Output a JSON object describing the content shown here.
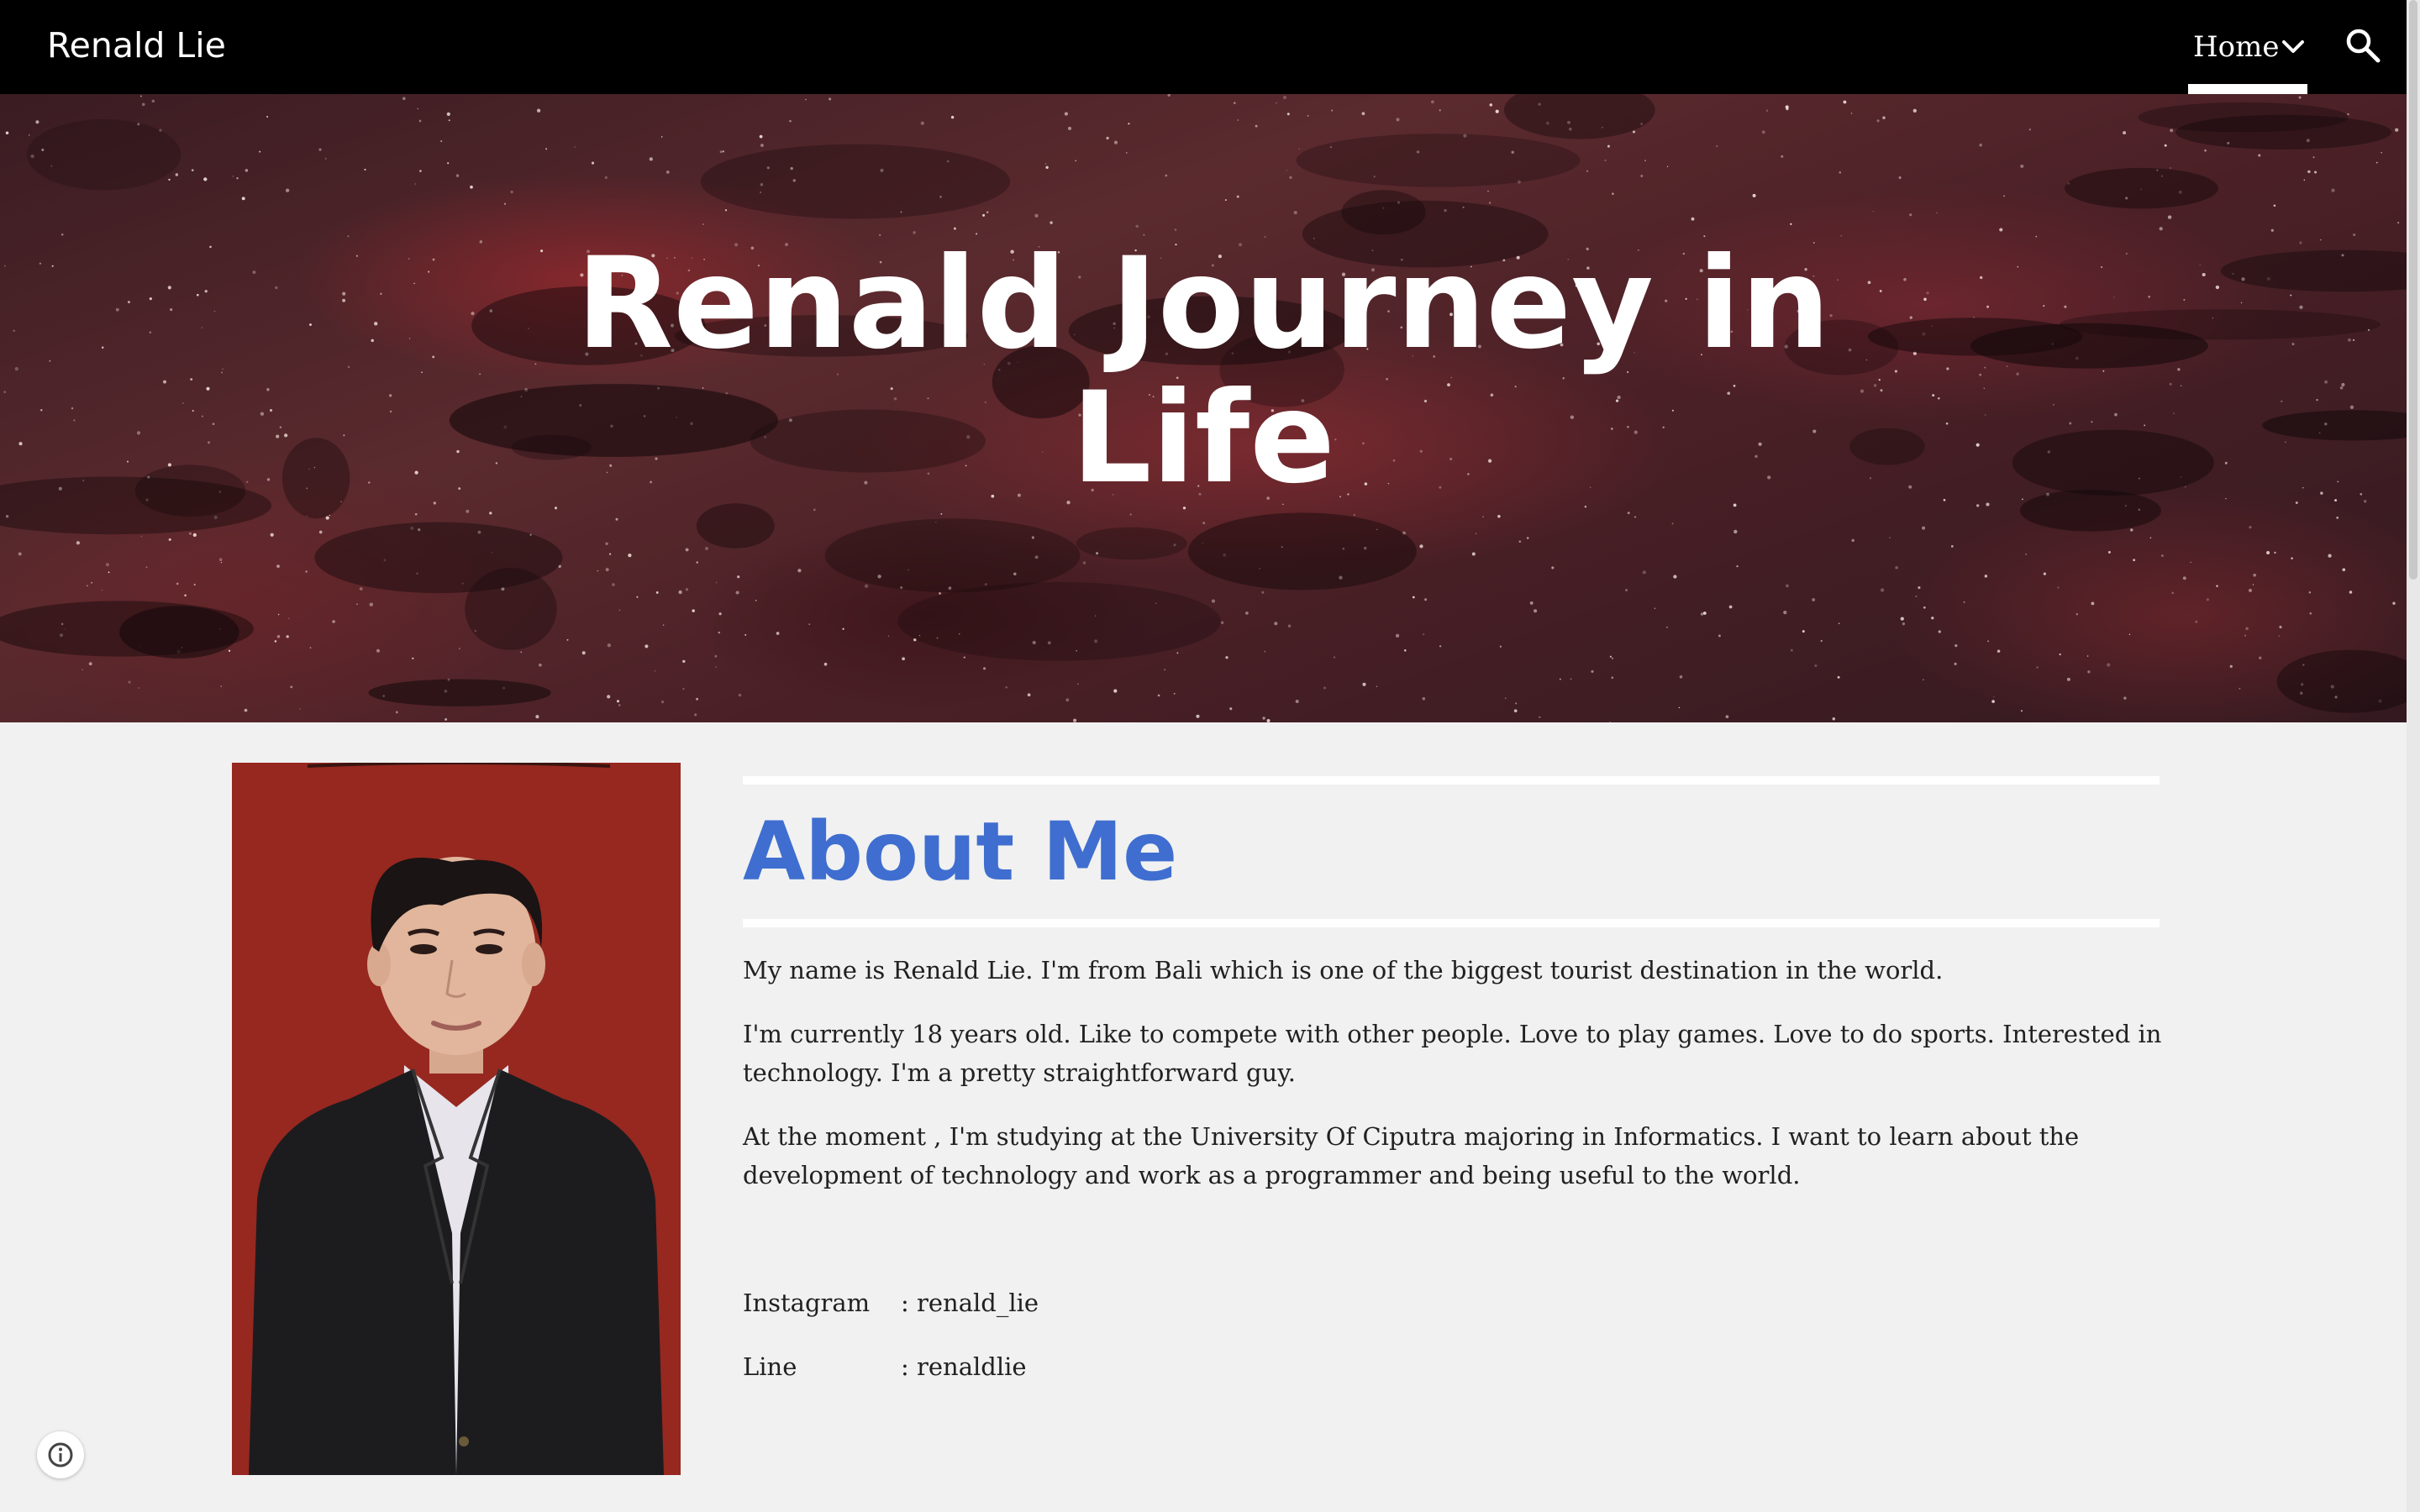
{
  "header": {
    "site_title": "Renald Lie",
    "nav": [
      {
        "label": "Home",
        "icon": "chevron-down-icon",
        "active": true
      }
    ],
    "search_icon": "search-icon"
  },
  "hero": {
    "title_line1": "Renald Journey in",
    "title_line2": "Life"
  },
  "about": {
    "heading": "About Me",
    "heading_color": "#3f6ed0",
    "paragraphs": [
      "My name is Renald Lie. I'm from Bali which is one of the biggest tourist destination in the world.",
      "I'm currently 18 years old. Like to compete with other people. Love to play games. Love to do sports. Interested in technology. I'm a pretty straightforward guy.",
      "At the moment , I'm studying at the University Of Ciputra majoring in Informatics. I want to learn about the development of technology and work as a programmer and being useful to the world."
    ],
    "contacts": [
      {
        "label": "Instagram",
        "value": ": renald_lie"
      },
      {
        "label": "Line",
        "value": ": renaldlie"
      }
    ]
  },
  "footer": {
    "info_icon": "info-icon"
  },
  "colors": {
    "topbar": "#000000",
    "page_background": "#f1f1f1",
    "photo_background": "#962820"
  }
}
